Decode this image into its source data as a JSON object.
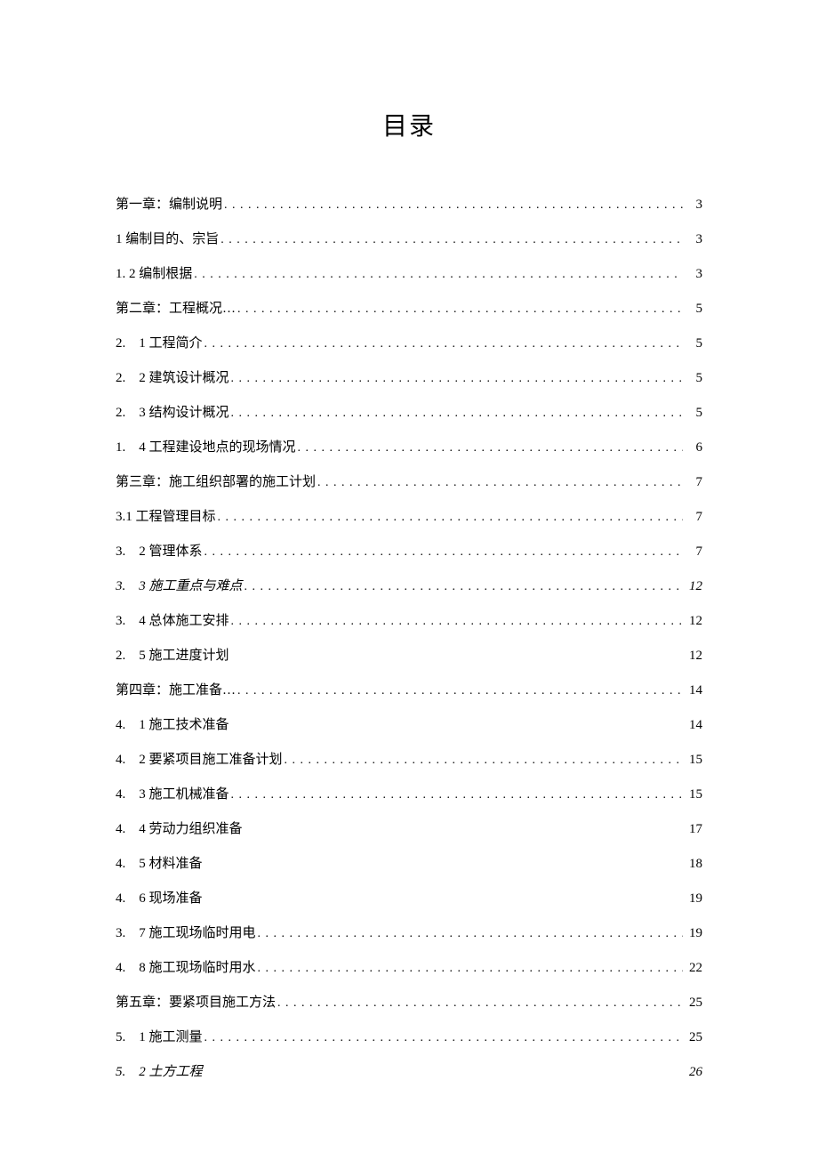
{
  "title": "目录",
  "toc": [
    {
      "label": "第一章：编制说明",
      "page": "3",
      "dots": true,
      "italic": false
    },
    {
      "label": "1 编制目的、宗旨",
      "page": "3",
      "dots": true,
      "italic": false
    },
    {
      "label": "1. 2 编制根据",
      "page": "3",
      "dots": true,
      "italic": false
    },
    {
      "label": "第二章：工程概况…",
      "page": "5",
      "dots": true,
      "italic": false
    },
    {
      "label": "2.　1 工程简介",
      "page": "5",
      "dots": true,
      "italic": false
    },
    {
      "label": "2.　2 建筑设计概况",
      "page": "5",
      "dots": true,
      "italic": false
    },
    {
      "label": "2.　3 结构设计概况",
      "page": "5",
      "dots": true,
      "italic": false
    },
    {
      "label": "1.　4 工程建设地点的现场情况",
      "page": "6",
      "dots": true,
      "italic": false
    },
    {
      "label": "第三章：施工组织部署的施工计划",
      "page": "7",
      "dots": true,
      "italic": false
    },
    {
      "label": "3.1 工程管理目标",
      "page": "7",
      "dots": true,
      "italic": false
    },
    {
      "label": "3.　2 管理体系",
      "page": "7",
      "dots": true,
      "italic": false
    },
    {
      "label": "3.　3 施工重点与难点",
      "page": "12",
      "dots": true,
      "italic": true
    },
    {
      "label": "3.　4 总体施工安排",
      "page": "12",
      "dots": true,
      "italic": false
    },
    {
      "label": "2.　5 施工进度计划",
      "page": "12",
      "dots": false,
      "italic": false
    },
    {
      "label": "第四章：施工准备…",
      "page": "14",
      "dots": true,
      "italic": false
    },
    {
      "label": "4.　1 施工技术准备",
      "page": "14",
      "dots": false,
      "italic": false
    },
    {
      "label": "4.　2 要紧项目施工准备计划",
      "page": "15",
      "dots": true,
      "italic": false
    },
    {
      "label": "4.　3 施工机械准备",
      "page": "15",
      "dots": true,
      "italic": false
    },
    {
      "label": "4.　4 劳动力组织准备",
      "page": "17",
      "dots": false,
      "italic": false
    },
    {
      "label": "4.　5 材料准备",
      "page": "18",
      "dots": false,
      "italic": false
    },
    {
      "label": "4.　6 现场准备",
      "page": "19",
      "dots": false,
      "italic": false
    },
    {
      "label": "3.　7 施工现场临时用电",
      "page": "19",
      "dots": true,
      "italic": false
    },
    {
      "label": "4.　8 施工现场临时用水",
      "page": "22",
      "dots": true,
      "italic": false
    },
    {
      "label": "第五章：要紧项目施工方法",
      "page": "25",
      "dots": true,
      "italic": false
    },
    {
      "label": "5.　1 施工测量",
      "page": "25",
      "dots": true,
      "italic": false
    },
    {
      "label": "5.　2 土方工程",
      "page": "26",
      "dots": false,
      "italic": true
    }
  ]
}
